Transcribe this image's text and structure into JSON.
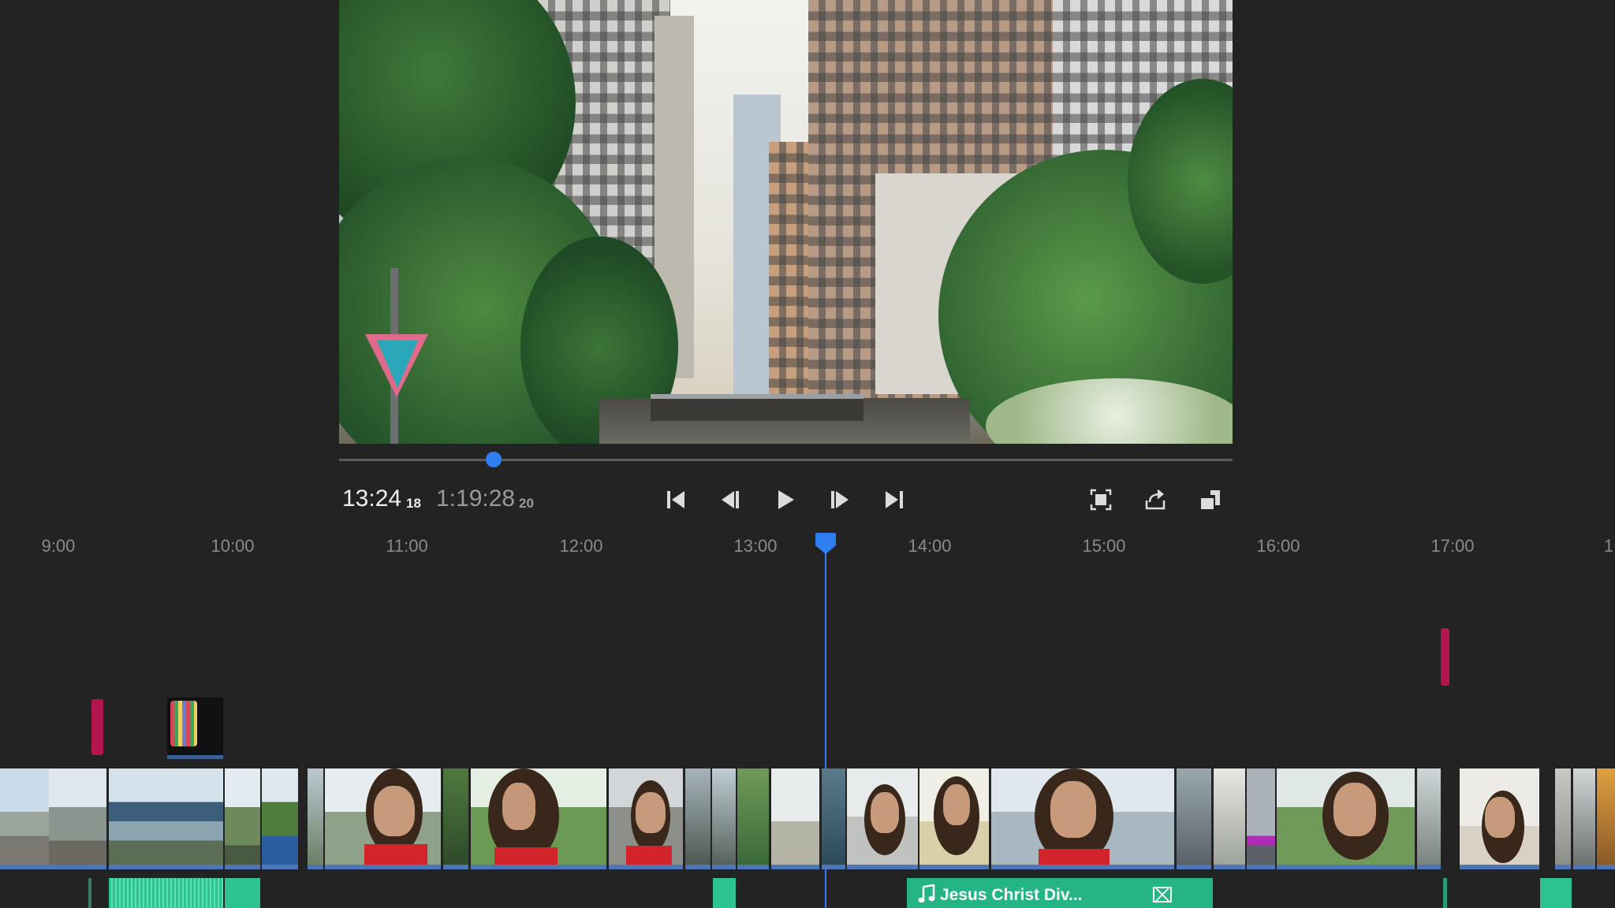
{
  "viewer": {
    "description_icon": "video-preview"
  },
  "scrubber": {
    "progress_fraction": 0.173
  },
  "timecode": {
    "current": "13:24",
    "current_frames": "18",
    "total": "1:19:28",
    "total_frames": "20"
  },
  "controls": {
    "icons": [
      "skip-to-start-icon",
      "step-back-icon",
      "play-icon",
      "step-forward-icon",
      "skip-to-end-icon",
      "fit-to-screen-icon",
      "share-icon",
      "expand-icon"
    ]
  },
  "ruler": {
    "ticks": [
      "9:00",
      "10:00",
      "11:00",
      "12:00",
      "13:00",
      "14:00",
      "15:00",
      "16:00",
      "17:00",
      "1"
    ]
  },
  "playhead": {
    "time": "13:24"
  },
  "audio": {
    "music_clip_label": "Jesus Christ Div..."
  },
  "colors": {
    "accent": "#2f7ff0",
    "marker": "#b3164f",
    "audio": "#2ec492",
    "video_track_border": "#4c76b8"
  }
}
